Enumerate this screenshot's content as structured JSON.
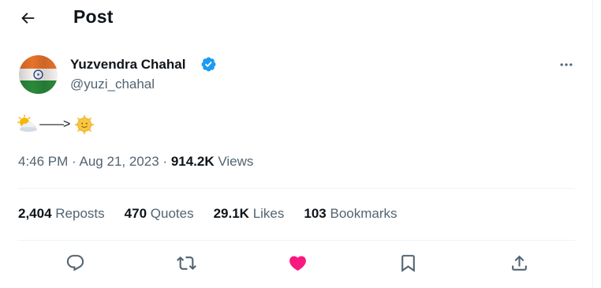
{
  "header": {
    "title": "Post",
    "back_icon": "arrow-left-icon"
  },
  "author": {
    "name": "Yuzvendra Chahal",
    "handle": "@yuzi_chahal",
    "verified": true,
    "verified_color": "#1d9bf0"
  },
  "tweet": {
    "arrow": "——>",
    "emoji_start": "sun-behind-cloud-emoji",
    "emoji_end": "sun-with-face-emoji"
  },
  "meta": {
    "time": "4:46 PM",
    "date": "Aug 21, 2023",
    "views_count": "914.2K",
    "views_label": "Views",
    "separator": "·"
  },
  "stats": [
    {
      "count": "2,404",
      "label": "Reposts"
    },
    {
      "count": "470",
      "label": "Quotes"
    },
    {
      "count": "29.1K",
      "label": "Likes"
    },
    {
      "count": "103",
      "label": "Bookmarks"
    }
  ],
  "actions": {
    "reply_icon": "reply-icon",
    "repost_icon": "repost-icon",
    "like_icon": "heart-icon",
    "like_color": "#f91880",
    "bookmark_icon": "bookmark-icon",
    "share_icon": "share-icon"
  },
  "colors": {
    "text": "#0f1419",
    "secondary": "#536471",
    "border": "#eff3f4"
  }
}
